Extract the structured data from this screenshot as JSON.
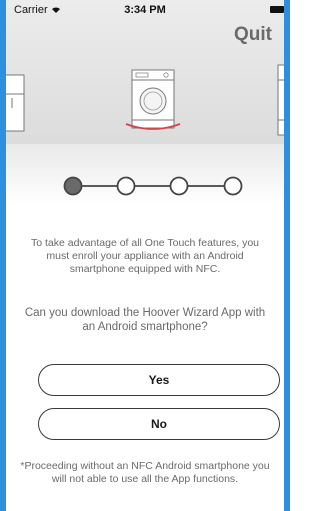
{
  "status_bar": {
    "carrier": "Carrier",
    "time": "3:34 PM"
  },
  "header": {
    "quit_label": "Quit"
  },
  "carousel": {
    "items": [
      "fridge-icon",
      "washing-machine-icon",
      "oven-icon"
    ],
    "selected_index": 1,
    "selection_color": "#d9444b"
  },
  "stepper": {
    "total_steps": 4,
    "current_step": 1
  },
  "content": {
    "intro": "To take advantage of all One Touch features, you must enroll your appliance with an Android smartphone equipped with NFC.",
    "question": "Can you download the Hoover Wizard App with an Android smartphone?"
  },
  "actions": {
    "yes_label": "Yes",
    "no_label": "No"
  },
  "footnote": "*Proceeding without an NFC Android smartphone you will not able to use all the App functions.",
  "colors": {
    "frame": "#2d8fe0",
    "text": "#6a6a6a",
    "hero_bg": "#e4e4e4"
  }
}
